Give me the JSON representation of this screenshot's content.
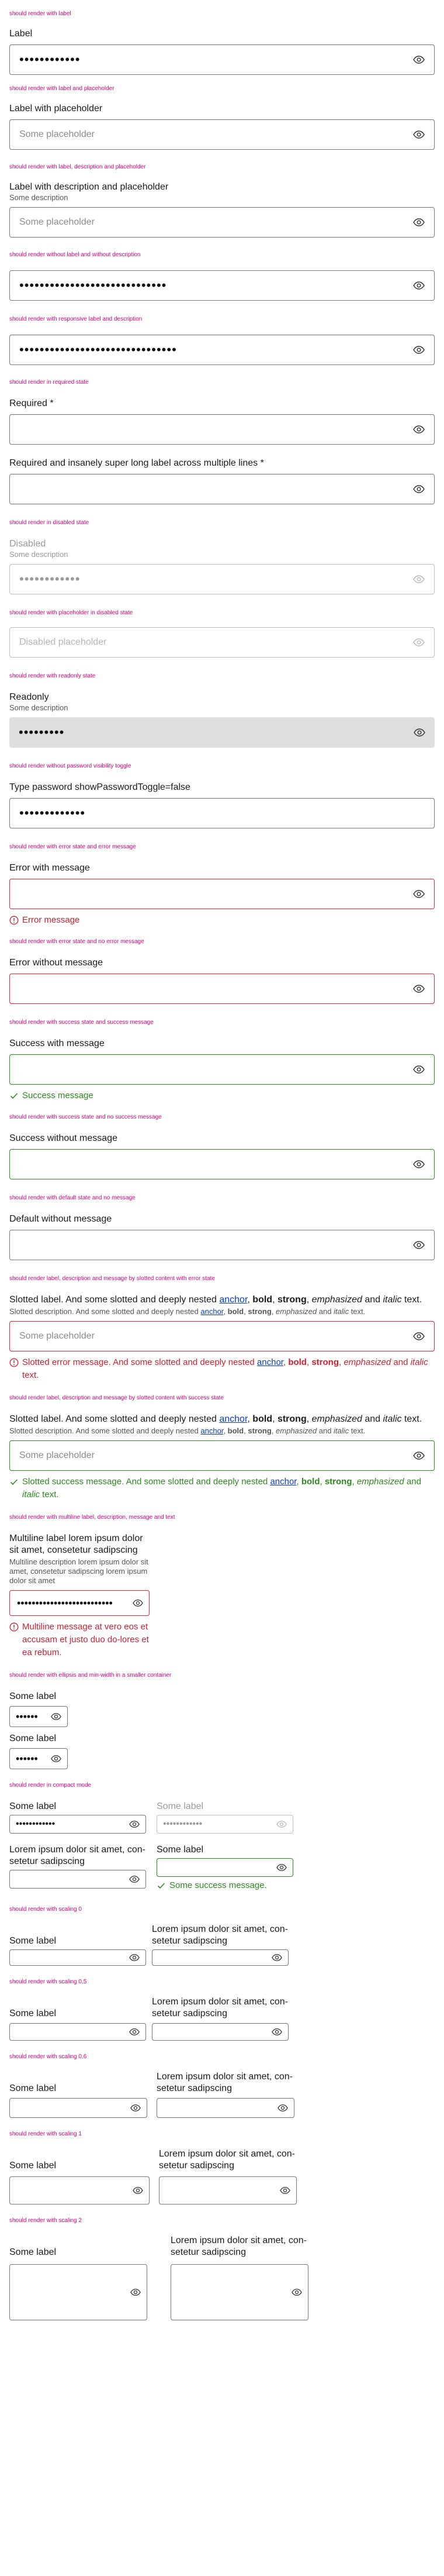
{
  "sections": {
    "s1": {
      "caption": "should render with label",
      "label": "Label",
      "value": "••••••••••••"
    },
    "s2": {
      "caption": "should render with label and placeholder",
      "label": "Label with placeholder",
      "placeholder": "Some placeholder"
    },
    "s3": {
      "caption": "should render with label, description and placeholder",
      "label": "Label with description and placeholder",
      "description": "Some description",
      "placeholder": "Some placeholder"
    },
    "s4": {
      "caption": "should render without label and without description",
      "value": "•••••••••••••••••••••••••••••"
    },
    "s5": {
      "caption": "should render with responsive label and description",
      "value": "•••••••••••••••••••••••••••••••"
    },
    "s6": {
      "caption": "should render in required state",
      "label1": "Required *",
      "label2": "Required and insanely super long label across multiple lines *"
    },
    "s7": {
      "caption": "should render in disabled state",
      "label": "Disabled",
      "description": "Some description",
      "value": "••••••••••••"
    },
    "s8": {
      "caption": "should render with placeholder in disabled state",
      "placeholder": "Disabled placeholder"
    },
    "s9": {
      "caption": "should render with readonly state",
      "label": "Readonly",
      "description": "Some description",
      "value": "•••••••••"
    },
    "s10": {
      "caption": "should render without password visibility toggle",
      "label": "Type password showPasswordToggle=false",
      "value": "•••••••••••••"
    },
    "s11": {
      "caption": "should render with error state and error message",
      "label": "Error with message",
      "message": "Error message"
    },
    "s12": {
      "caption": "should render with error state and no error message",
      "label": "Error without message"
    },
    "s13": {
      "caption": "should render with success state and success message",
      "label": "Success with message",
      "message": "Success message"
    },
    "s14": {
      "caption": "should render with success state and no success message",
      "label": "Success without message"
    },
    "s15": {
      "caption": "should render with default state and no message",
      "label": "Default without message"
    },
    "s16": {
      "caption": "should render label, description and message by slotted content with error state",
      "label_a": "Slotted label. And some slotted and deeply nested ",
      "anchor": "anchor",
      "bold": "bold",
      "strong": "strong",
      "emphasized": "emphasized",
      "italic": "italic",
      "and_text": " and ",
      "text_end": " text.",
      "comma": ", ",
      "desc_a": "Slotted description. And some slotted and deeply nested ",
      "placeholder": "Some placeholder",
      "msg_a": "Slotted error message. And some slotted and deeply nested "
    },
    "s17": {
      "caption": "should render label, description and message by slotted content with success state",
      "label_a": "Slotted label. And some slotted and deeply nested ",
      "desc_a": "Slotted description. And some slotted and deeply nested ",
      "msg_a": "Slotted success message. And some slotted and deeply nested "
    },
    "s18": {
      "caption": "should render with multiline label, description, message and text",
      "label": "Multiline label lorem ipsum dolor sit amet, consetetur sadipscing",
      "description": "Multiline description lorem ipsum dolor sit amet, consetetur sadipscing lorem ipsum dolor sit amet",
      "value": "••••••••••••••••••••••••••",
      "message": "Multiline message at vero eos et accusam et justo duo do-lores et ea rebum."
    },
    "s19": {
      "caption": "should render with ellipsis and min-width in a smaller container",
      "label1": "Some label",
      "label2": "Some label",
      "value": "••••••"
    },
    "s20": {
      "caption": "should render in compact mode",
      "label_a": "Some label",
      "label_b": "Some label",
      "value_a": "••••••••••••",
      "value_b": "••••••••••••",
      "long_label": "Lorem ipsum dolor sit amet, con-setetur sadipscing",
      "label_c": "Some label",
      "success_msg": "Some success message."
    },
    "s21": {
      "caption": "should render with scaling 0",
      "label": "Some label",
      "long_label": "Lorem ipsum dolor sit amet, con-setetur sadipscing"
    },
    "s22": {
      "caption": "should render with scaling 0.5",
      "label": "Some label",
      "long_label": "Lorem ipsum dolor sit amet, con-setetur sadipscing"
    },
    "s23": {
      "caption": "should render with scaling 0.6",
      "label": "Some label",
      "long_label": "Lorem ipsum dolor sit amet, con-setetur sadipscing"
    },
    "s24": {
      "caption": "should render with scaling 1",
      "label": "Some label",
      "long_label": "Lorem ipsum dolor sit amet, con-setetur sadipscing"
    },
    "s25": {
      "caption": "should render with scaling 2",
      "label": "Some label",
      "long_label": "Lorem ipsum dolor sit amet, con-setetur sadipscing"
    }
  },
  "colors": {
    "caption": "#d5007f",
    "error": "#e12338",
    "success": "#2d8a1e",
    "link": "#0a3bd6"
  },
  "icons": {
    "toggle": "eye-icon",
    "error": "exclamation-circle-icon",
    "success": "check-icon"
  }
}
